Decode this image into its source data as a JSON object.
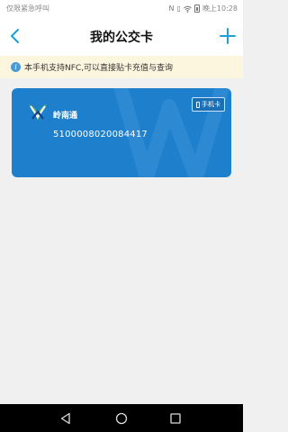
{
  "status_bar": {
    "carrier_text": "仅限紧急呼叫",
    "time": "晚上10:28",
    "icons": [
      "nfc-icon",
      "vibrate-icon",
      "wifi-icon",
      "battery-icon"
    ]
  },
  "header": {
    "title": "我的公交卡",
    "back_icon": "chevron-left-icon",
    "add_icon": "plus-icon",
    "accent_color": "#1aa0d8"
  },
  "notice": {
    "text": "本手机支持NFC,可以直接贴卡充值与查询",
    "icon": "info-icon",
    "background": "#fdf6df"
  },
  "card": {
    "name": "岭南通",
    "number": "5100008020084417",
    "tag_label": "手机卡",
    "color": "#1e7fcc"
  },
  "nav_bar": {
    "buttons": [
      "back-triangle-icon",
      "home-circle-icon",
      "recents-square-icon"
    ]
  }
}
